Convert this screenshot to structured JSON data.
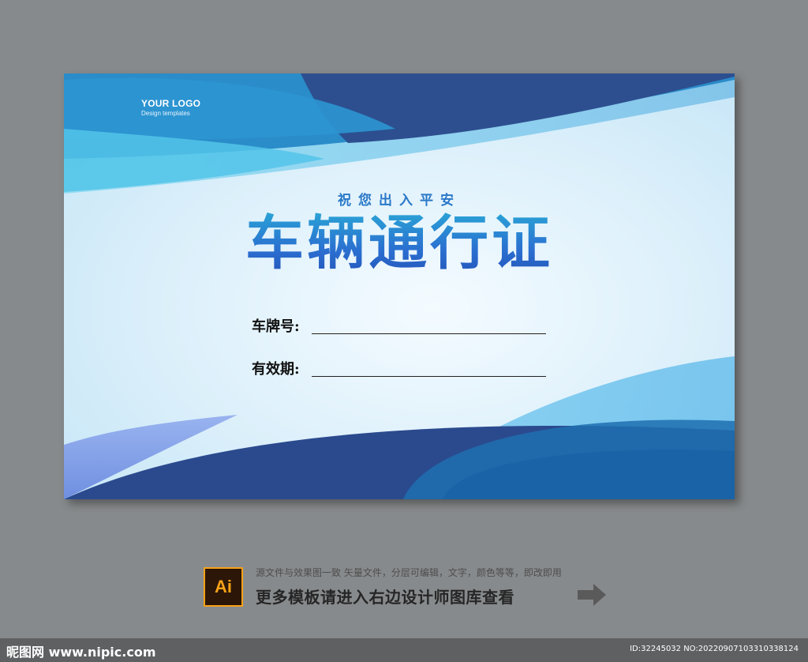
{
  "card": {
    "logo_title": "YOUR LOGO",
    "logo_subtitle": "Design templates",
    "greeting": "祝您出入平安",
    "title": "车辆通行证",
    "fields": [
      {
        "label": "车牌号:"
      },
      {
        "label": "有效期:"
      }
    ]
  },
  "footer": {
    "app_badge": "Ai",
    "description": "源文件与效果图一致 矢量文件，分层可编辑，文字，颜色等等，即改即用",
    "promo": "更多模板请进入右边设计师图库查看",
    "arrow_icon": "arrow-right-icon"
  },
  "watermark": {
    "site": "昵图网 www.nipic.com",
    "id_text": "ID:32245032 NO:20220907103310338124"
  },
  "colors": {
    "page_bg": "#878a8c",
    "title_blue": "#2a6fd0",
    "dark_navy": "#1e3f86",
    "mid_blue": "#2a7cc0",
    "light_cyan": "#4fc0e6",
    "ai_orange": "#f7a118"
  }
}
